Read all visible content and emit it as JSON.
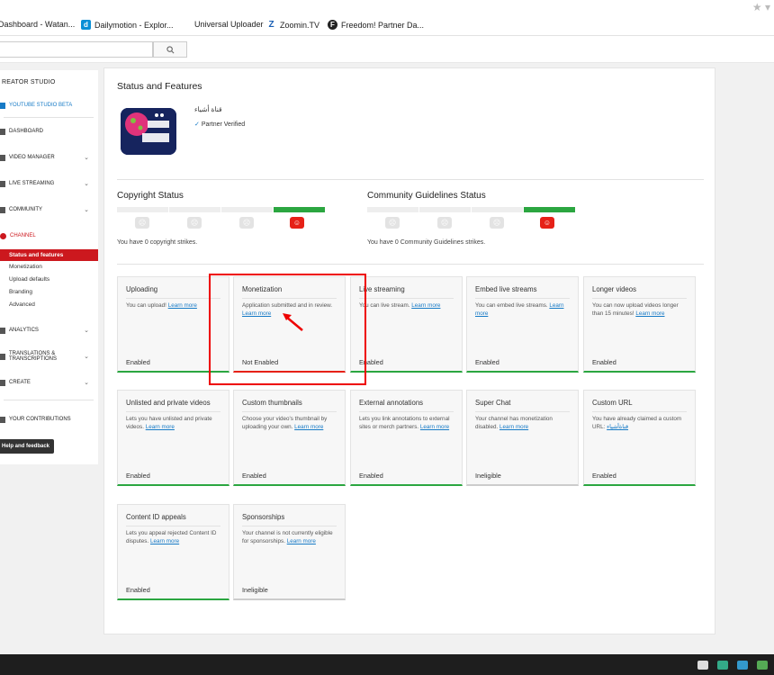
{
  "bookmarks": [
    {
      "label": "Dashboard - Watan...",
      "icon": "blank-page-icon"
    },
    {
      "label": "Dailymotion - Explor...",
      "icon": "dailymotion-icon",
      "fav": "d"
    },
    {
      "label": "Universal Uploader",
      "icon": "blank-page-icon"
    },
    {
      "label": "Zoomin.TV",
      "icon": "zoomin-icon",
      "fav": "Z"
    },
    {
      "label": "Freedom! Partner Da...",
      "icon": "freedom-icon",
      "fav": "F"
    }
  ],
  "sidebar": {
    "title": "REATOR STUDIO",
    "items": [
      {
        "label": "YOUTUBE STUDIO BETA",
        "icon": "studio-gear-icon"
      },
      {
        "label": "DASHBOARD",
        "icon": "dashboard-icon"
      },
      {
        "label": "VIDEO MANAGER",
        "icon": "video-manager-icon"
      },
      {
        "label": "LIVE STREAMING",
        "icon": "live-streaming-icon"
      },
      {
        "label": "COMMUNITY",
        "icon": "community-icon"
      },
      {
        "label": "CHANNEL",
        "icon": "channel-icon"
      },
      {
        "label": "ANALYTICS",
        "icon": "analytics-icon"
      },
      {
        "label": "TRANSLATIONS & TRANSCRIPTIONS",
        "icon": "translations-icon"
      },
      {
        "label": "CREATE",
        "icon": "create-icon"
      },
      {
        "label": "YOUR CONTRIBUTIONS",
        "icon": "contributions-icon"
      }
    ],
    "channel_subitems": [
      "Status and features",
      "Monetization",
      "Upload defaults",
      "Branding",
      "Advanced"
    ],
    "help_label": "Help and feedback"
  },
  "main": {
    "title": "Status and Features",
    "channel_name": "قناة أشياء",
    "avatar_text": "قناة أشياء",
    "partner_status": "Partner Verified",
    "copyright": {
      "title": "Copyright Status",
      "text": "You have 0 copyright strikes."
    },
    "community": {
      "title": "Community Guidelines Status",
      "text": "You have 0 Community Guidelines strikes."
    },
    "features": [
      {
        "title": "Uploading",
        "desc": "You can upload!",
        "link": "Learn more",
        "status": "Enabled",
        "state": "enabled"
      },
      {
        "title": "Monetization",
        "desc": "Application submitted and in review.",
        "link": "Learn more",
        "status": "Not Enabled",
        "state": "not-enabled"
      },
      {
        "title": "Live streaming",
        "desc": "You can live stream.",
        "link": "Learn more",
        "status": "Enabled",
        "state": "enabled"
      },
      {
        "title": "Embed live streams",
        "desc": "You can embed live streams.",
        "link": "Learn more",
        "status": "Enabled",
        "state": "enabled"
      },
      {
        "title": "Longer videos",
        "desc": "You can now upload videos longer than 15 minutes!",
        "link": "Learn more",
        "status": "Enabled",
        "state": "enabled"
      },
      {
        "title": "Unlisted and private videos",
        "desc": "Lets you have unlisted and private videos.",
        "link": "Learn more",
        "status": "Enabled",
        "state": "enabled"
      },
      {
        "title": "Custom thumbnails",
        "desc": "Choose your video's thumbnail by uploading your own.",
        "link": "Learn more",
        "status": "Enabled",
        "state": "enabled"
      },
      {
        "title": "External annotations",
        "desc": "Lets you link annotations to external sites or merch partners.",
        "link": "Learn more",
        "status": "Enabled",
        "state": "enabled"
      },
      {
        "title": "Super Chat",
        "desc": "Your channel has monetization disabled.",
        "link": "Learn more",
        "status": "Ineligible",
        "state": "ineligible"
      },
      {
        "title": "Custom URL",
        "desc": "You have already claimed a custom URL:",
        "link": "قناةأشياء",
        "status": "Enabled",
        "state": "enabled"
      },
      {
        "title": "Content ID appeals",
        "desc": "Lets you appeal rejected Content ID disputes.",
        "link": "Learn more",
        "status": "Enabled",
        "state": "enabled"
      },
      {
        "title": "Sponsorships",
        "desc": "Your channel is not currently eligible for sponsorships.",
        "link": "Learn more",
        "status": "Ineligible",
        "state": "ineligible"
      }
    ]
  },
  "colors": {
    "accent_red": "#cc181e",
    "enabled_green": "#2ba640",
    "link_blue": "#167ac6"
  }
}
